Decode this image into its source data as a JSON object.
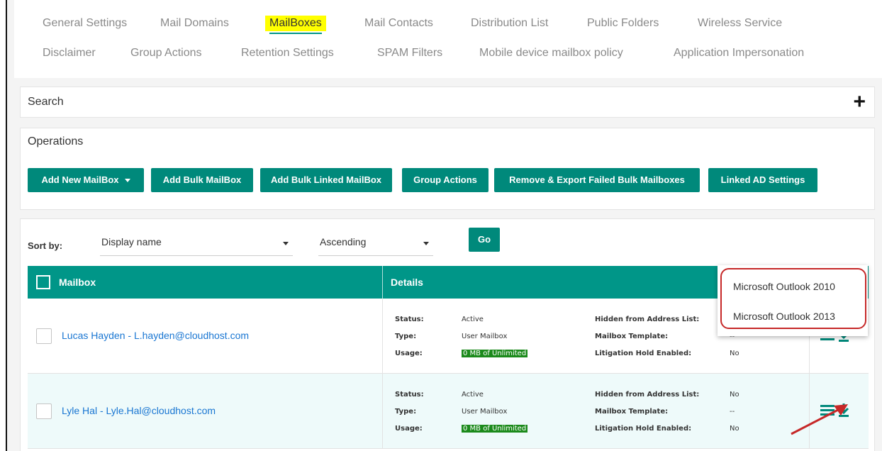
{
  "tabs": {
    "row1": [
      "General Settings",
      "Mail Domains",
      "MailBoxes",
      "Mail Contacts",
      "Distribution List",
      "Public Folders",
      "Wireless Service"
    ],
    "row2": [
      "Disclaimer",
      "Group Actions",
      "Retention Settings",
      "SPAM Filters",
      "Mobile device mailbox policy",
      "Application Impersonation"
    ],
    "active": "MailBoxes"
  },
  "search": {
    "title": "Search",
    "expand_symbol": "+"
  },
  "operations": {
    "title": "Operations",
    "buttons": [
      "Add New MailBox",
      "Add Bulk MailBox",
      "Add Bulk Linked MailBox",
      "Group Actions",
      "Remove & Export Failed Bulk Mailboxes",
      "Linked AD Settings"
    ]
  },
  "sort": {
    "label": "Sort by:",
    "field": "Display name",
    "order": "Ascending",
    "go_label": "Go"
  },
  "table": {
    "headers": {
      "mailbox": "Mailbox",
      "details": "Details"
    },
    "detail_labels": {
      "status": "Status:",
      "type": "Type:",
      "usage": "Usage:",
      "hidden": "Hidden from Address List:",
      "template": "Mailbox Template:",
      "litigation": "Litigation Hold Enabled:"
    },
    "rows": [
      {
        "name": "Lucas Hayden - L.hayden@cloudhost.com",
        "status": "Active",
        "type": "User Mailbox",
        "usage": "0 MB of Unlimited",
        "hidden": "",
        "template": "--",
        "litigation": "No"
      },
      {
        "name": "Lyle Hal - Lyle.Hal@cloudhost.com",
        "status": "Active",
        "type": "User Mailbox",
        "usage": "0 MB of Unlimited",
        "hidden": "No",
        "template": "--",
        "litigation": "No"
      }
    ]
  },
  "dropdown": {
    "items": [
      "Microsoft Outlook 2010",
      "Microsoft Outlook 2013"
    ]
  },
  "colors": {
    "teal": "#009688",
    "button": "#00897b",
    "highlight": "#ffff00",
    "annotation": "#c62828",
    "usage_badge": "#1b8a1b",
    "link": "#1976d2"
  }
}
